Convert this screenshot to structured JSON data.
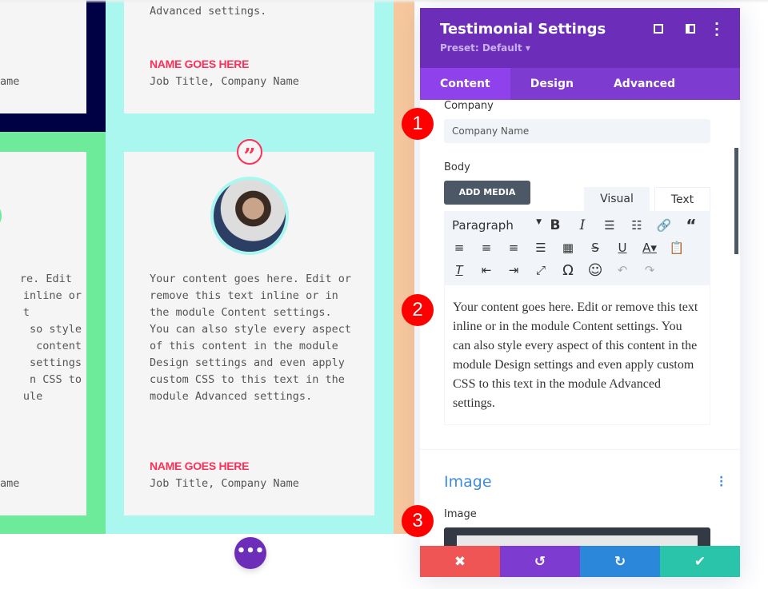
{
  "left_column": {
    "partial_body_lines": [
      "re. Edit",
      "inline or",
      "t",
      "so style",
      "content",
      "settings",
      "n CSS to",
      "ule"
    ],
    "partial_job_top": "ame",
    "partial_job_bottom": "ame"
  },
  "middle_column": {
    "top_card": {
      "body_tail": "Advanced settings.",
      "name": "NAME GOES HERE",
      "job": "Job Title, Company Name"
    },
    "bottom_card": {
      "body": "Your content goes here. Edit or remove this text inline or in the module Content settings. You can also style every aspect of this content in the module Design settings and even apply custom CSS to this text in the module Advanced settings.",
      "name": "NAME GOES HERE",
      "job": "Job Title, Company Name"
    }
  },
  "colors": {
    "navy": "#000044",
    "green": "#6deb9a",
    "cyan": "#aaf7f0",
    "peach": "#f7c89d",
    "accent": "#ff2f57",
    "purple": "#6c2eb9"
  },
  "panel": {
    "title": "Testimonial Settings",
    "preset": "Preset: Default ▾",
    "tabs": [
      "Content",
      "Design",
      "Advanced"
    ],
    "company_label": "Company",
    "company_value": "Company Name",
    "body_label": "Body",
    "add_media": "ADD MEDIA",
    "editor_tabs": [
      "Visual",
      "Text"
    ],
    "format_select": "Paragraph",
    "body_text": "Your content goes here. Edit or remove this text inline or in the module Content settings. You can also style every aspect of this content in the module Design settings and even apply custom CSS to this text in the module Advanced settings.",
    "image_section": "Image",
    "image_label": "Image"
  },
  "badges": [
    "1",
    "2",
    "3"
  ]
}
